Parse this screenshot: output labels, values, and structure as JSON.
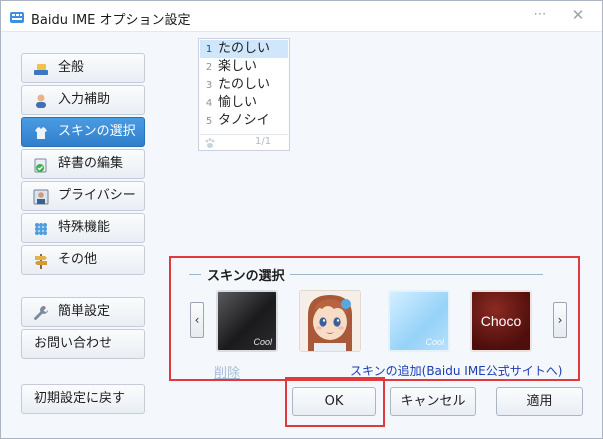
{
  "window": {
    "title": "Baidu IME オプション設定"
  },
  "titlebar": {
    "minimize_symbol": "⋯",
    "close_symbol": "✕"
  },
  "sidebar": {
    "items": [
      {
        "label": "全般",
        "icon": "general-icon"
      },
      {
        "label": "入力補助",
        "icon": "user-icon"
      },
      {
        "label": "スキンの選択",
        "icon": "skin-icon",
        "active": true
      },
      {
        "label": "辞書の編集",
        "icon": "dictionary-icon"
      },
      {
        "label": "プライバシー",
        "icon": "privacy-icon"
      },
      {
        "label": "特殊機能",
        "icon": "special-icon"
      },
      {
        "label": "その他",
        "icon": "signpost-icon"
      }
    ],
    "simple_setting": "簡単設定",
    "contact": "お問い合わせ",
    "reset": "初期設定に戻す"
  },
  "candidates": {
    "items": [
      {
        "num": "1",
        "text": "たのしい",
        "selected": true
      },
      {
        "num": "2",
        "text": "楽しい"
      },
      {
        "num": "3",
        "text": "たのしい"
      },
      {
        "num": "4",
        "text": "愉しい"
      },
      {
        "num": "5",
        "text": "タノシイ"
      }
    ],
    "page": "1/1"
  },
  "skins": {
    "section_title": "スキンの選択",
    "prev_symbol": "‹",
    "next_symbol": "›",
    "items": [
      {
        "name": "cool-dark",
        "tag": "Cool"
      },
      {
        "name": "anime-girl",
        "tag": ""
      },
      {
        "name": "cool-blue",
        "tag": "Cool"
      },
      {
        "name": "choco",
        "label": "Choco"
      }
    ],
    "delete_label": "削除",
    "add_link": "スキンの追加(Baidu IME公式サイトへ)"
  },
  "buttons": {
    "ok": "OK",
    "cancel": "キャンセル",
    "apply": "適用"
  },
  "colors": {
    "accent": "#2f7fcc",
    "highlight": "#e0393e",
    "link": "#1a3db5"
  }
}
